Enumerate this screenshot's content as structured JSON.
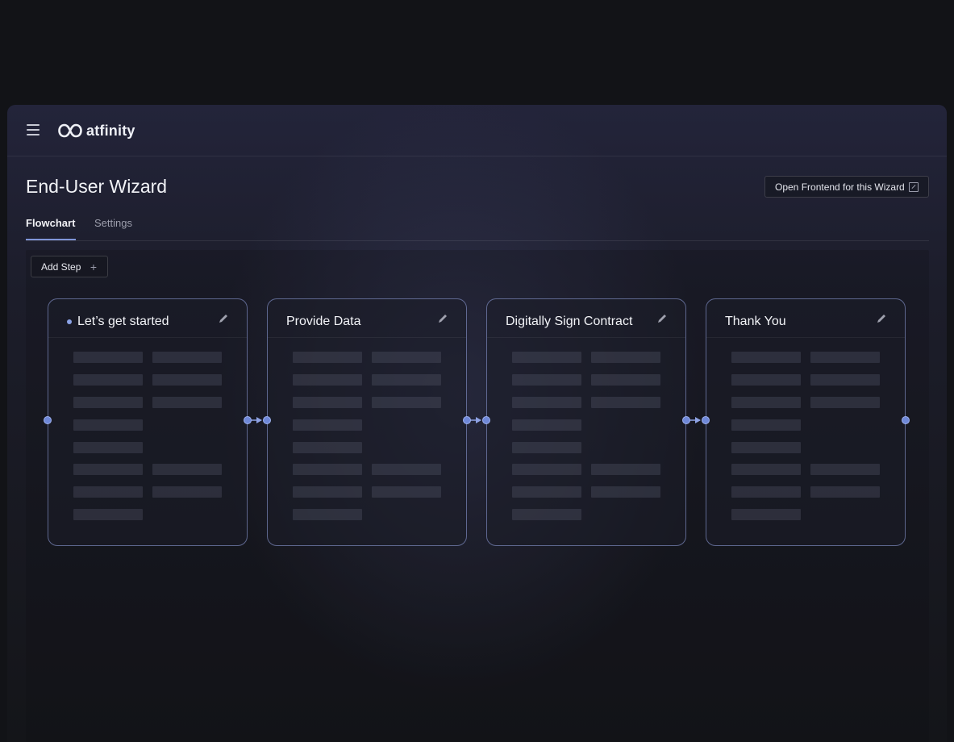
{
  "app": {
    "brand": "atfinity"
  },
  "page": {
    "title": "End-User Wizard",
    "open_frontend_label": "Open Frontend for this Wizard"
  },
  "tabs": [
    {
      "label": "Flowchart",
      "active": true
    },
    {
      "label": "Settings",
      "active": false
    }
  ],
  "toolbar": {
    "add_step_label": "Add Step"
  },
  "steps": [
    {
      "title": "Let’s get started",
      "start_marker": true
    },
    {
      "title": "Provide Data",
      "start_marker": false
    },
    {
      "title": "Digitally Sign Contract",
      "start_marker": false
    },
    {
      "title": "Thank You",
      "start_marker": false
    }
  ],
  "icons": {
    "menu": "hamburger-icon",
    "logo": "infinity-logo",
    "external": "external-link-icon",
    "add": "plus-icon",
    "edit": "pencil-icon"
  },
  "colors": {
    "accent": "#7f95d8",
    "port": "#6f88d8",
    "card_border": "#8c9bd7",
    "background": "#121317"
  }
}
